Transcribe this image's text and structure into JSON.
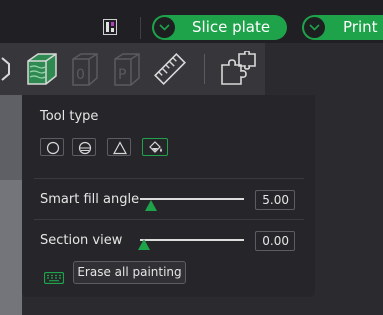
{
  "topbar": {
    "slice_label": "Slice plate",
    "print_label": "Print p",
    "accent": "#1ea34a"
  },
  "iconbar": {
    "icons": [
      "axis-icon",
      "layer-paint-icon",
      "filament-0-icon",
      "filament-p-icon",
      "ruler-icon",
      "assembly-puzzle-icon"
    ]
  },
  "panel": {
    "tool_type_label": "Tool type",
    "tools": [
      "circle-brush-icon",
      "sphere-brush-icon",
      "triangle-brush-icon",
      "fill-bucket-icon"
    ],
    "active_tool": "fill-bucket-icon",
    "smart_fill": {
      "label": "Smart fill angle",
      "value": "5.00",
      "level": 0.1
    },
    "section_view": {
      "label": "Section view",
      "value": "0.00",
      "level": 0.0
    },
    "erase_label": "Erase all painting"
  }
}
